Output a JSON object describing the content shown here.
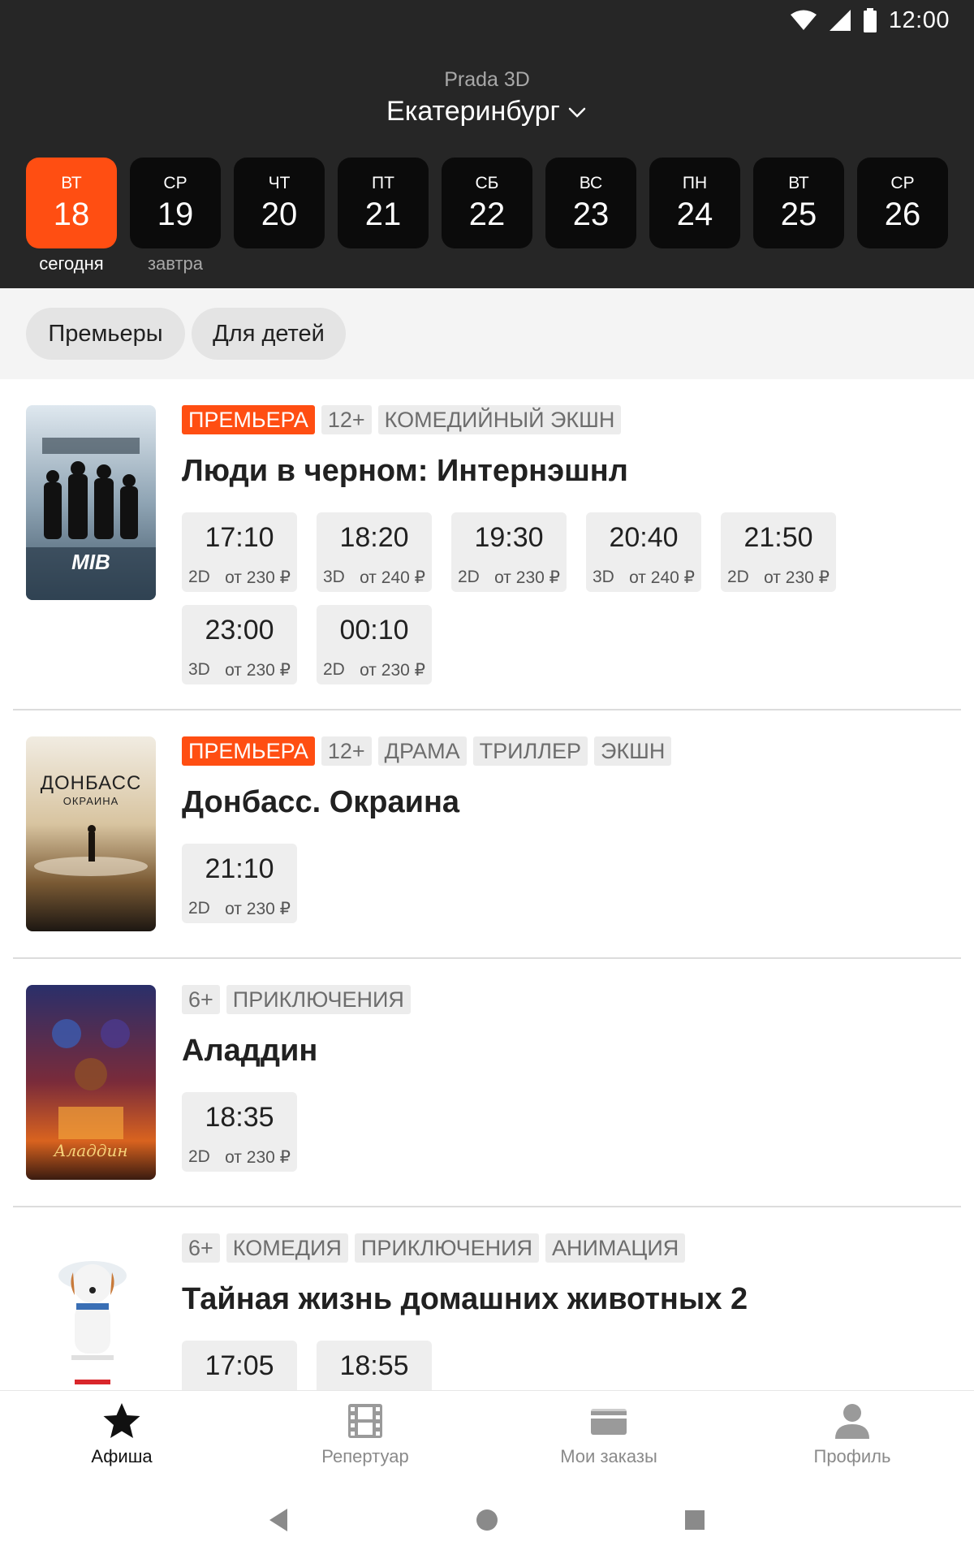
{
  "status": {
    "time": "12:00",
    "icons": [
      "wifi-icon",
      "signal-icon",
      "battery-icon"
    ]
  },
  "header": {
    "cinema": "Prada 3D",
    "city": "Екатеринбург"
  },
  "dates": [
    {
      "dow": "ВТ",
      "num": "18",
      "sub": "сегодня",
      "active": true
    },
    {
      "dow": "СР",
      "num": "19",
      "sub": "завтра"
    },
    {
      "dow": "ЧТ",
      "num": "20",
      "sub": ""
    },
    {
      "dow": "ПТ",
      "num": "21",
      "sub": ""
    },
    {
      "dow": "СБ",
      "num": "22",
      "sub": ""
    },
    {
      "dow": "ВС",
      "num": "23",
      "sub": ""
    },
    {
      "dow": "ПН",
      "num": "24",
      "sub": ""
    },
    {
      "dow": "ВТ",
      "num": "25",
      "sub": ""
    },
    {
      "dow": "СР",
      "num": "26",
      "sub": ""
    }
  ],
  "filters": [
    "Премьеры",
    "Для детей"
  ],
  "movies": [
    {
      "tags": [
        "ПРЕМЬЕРА",
        "12+",
        "КОМЕДИЙНЫЙ ЭКШН"
      ],
      "title": "Люди в черном: Интернэшнл",
      "poster_text": "MIB",
      "shows": [
        {
          "time": "17:10",
          "fmt": "2D",
          "price": "от 230 ₽"
        },
        {
          "time": "18:20",
          "fmt": "3D",
          "price": "от 240 ₽"
        },
        {
          "time": "19:30",
          "fmt": "2D",
          "price": "от 230 ₽"
        },
        {
          "time": "20:40",
          "fmt": "3D",
          "price": "от 240 ₽"
        },
        {
          "time": "21:50",
          "fmt": "2D",
          "price": "от 230 ₽"
        },
        {
          "time": "23:00",
          "fmt": "3D",
          "price": "от 230 ₽"
        },
        {
          "time": "00:10",
          "fmt": "2D",
          "price": "от 230 ₽"
        }
      ]
    },
    {
      "tags": [
        "ПРЕМЬЕРА",
        "12+",
        "ДРАМА",
        "ТРИЛЛЕР",
        "ЭКШН"
      ],
      "title": "Донбасс. Окраина",
      "poster_text": "ДОНБАСС",
      "poster_sub": "ОКРАИНА",
      "shows": [
        {
          "time": "21:10",
          "fmt": "2D",
          "price": "от 230 ₽"
        }
      ]
    },
    {
      "tags": [
        "6+",
        "ПРИКЛЮЧЕНИЯ"
      ],
      "title": "Аладдин",
      "poster_text": "Аладдин",
      "shows": [
        {
          "time": "18:35",
          "fmt": "2D",
          "price": "от 230 ₽"
        }
      ]
    },
    {
      "tags": [
        "6+",
        "КОМЕДИЯ",
        "ПРИКЛЮЧЕНИЯ",
        "АНИМАЦИЯ"
      ],
      "title": "Тайная жизнь домашних животных 2",
      "poster_text": "",
      "shows": [
        {
          "time": "17:05",
          "fmt": "",
          "price": ""
        },
        {
          "time": "18:55",
          "fmt": "",
          "price": ""
        }
      ]
    }
  ],
  "bottom_nav": [
    {
      "label": "Афиша",
      "icon": "star-icon",
      "active": true
    },
    {
      "label": "Репертуар",
      "icon": "film-icon"
    },
    {
      "label": "Мои заказы",
      "icon": "ticket-icon"
    },
    {
      "label": "Профиль",
      "icon": "user-icon"
    }
  ],
  "system_nav": [
    "back-icon",
    "home-icon",
    "recents-icon"
  ],
  "colors": {
    "header_bg": "#262626",
    "accent": "#ff4e12",
    "tag_bg": "#ececec",
    "show_bg": "#eeeeee"
  }
}
